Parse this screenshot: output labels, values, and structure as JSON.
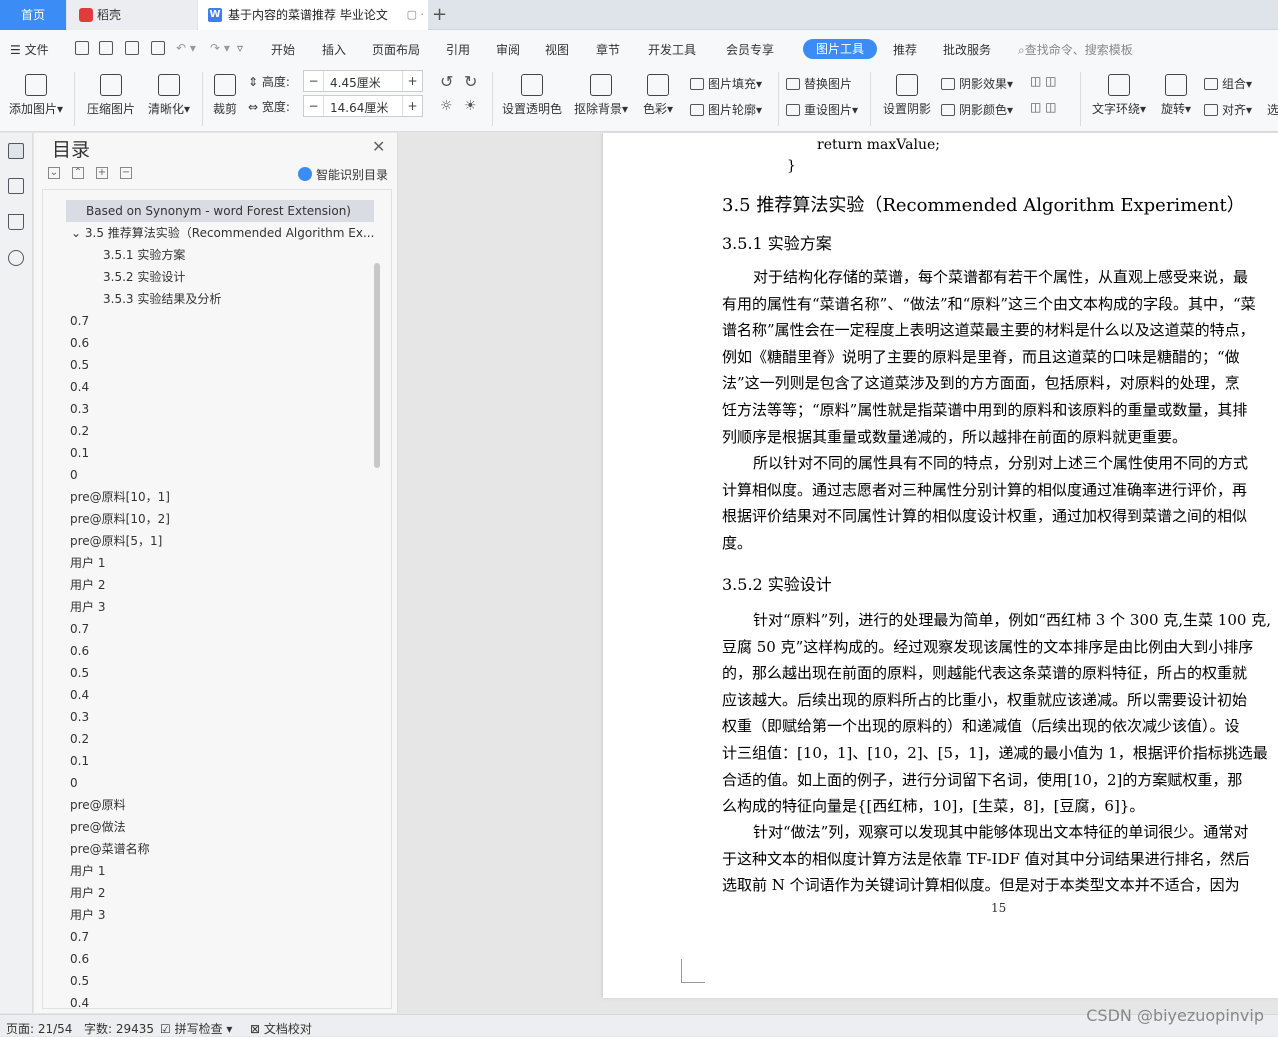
{
  "tabs": {
    "home": "首页",
    "daoke": "稻壳",
    "doc": "基于内容的菜谱推荐 毕业论文",
    "add": "+"
  },
  "menu": {
    "file": "文件",
    "items": [
      "开始",
      "插入",
      "页面布局",
      "引用",
      "审阅",
      "视图",
      "章节",
      "开发工具",
      "会员专享",
      "图片工具",
      "推荐",
      "批改服务"
    ],
    "search": "查找命令、搜索模板"
  },
  "ribbon": {
    "add_pic": "添加图片",
    "compress": "压缩图片",
    "clarify": "清晰化",
    "crop": "裁剪",
    "height_label": "高度:",
    "height_value": "4.45厘米",
    "width_label": "宽度:",
    "width_value": "14.64厘米",
    "transparent": "设置透明色",
    "remove_bg": "抠除背景",
    "color": "色彩",
    "fill": "图片填充",
    "outline": "图片轮廓",
    "replace": "替换图片",
    "reset": "重设图片",
    "shadow_set": "设置阴影",
    "shadow_effect": "阴影效果",
    "shadow_color": "阴影颜色",
    "wrap": "文字环绕",
    "rotate": "旋转",
    "group": "组合",
    "align": "对齐",
    "select": "选"
  },
  "toc": {
    "title": "目录",
    "smart": "智能识别目录",
    "items": [
      "Based on Synonym - word Forest Extension)",
      "3.5 推荐算法实验（Recommended Algorithm Ex...",
      "3.5.1 实验方案",
      "3.5.2 实验设计",
      "3.5.3 实验结果及分析",
      "0.7",
      "0.6",
      "0.5",
      "0.4",
      "0.3",
      "0.2",
      "0.1",
      "0",
      "pre@原料[10，1]",
      "pre@原料[10，2]",
      "pre@原料[5，1]",
      "用户 1",
      "用户 2",
      "用户 3",
      "0.7",
      "0.6",
      "0.5",
      "0.4",
      "0.3",
      "0.2",
      "0.1",
      "0",
      "pre@原料",
      "pre@做法",
      "pre@菜谱名称",
      "用户 1",
      "用户 2",
      "用户 3",
      "0.7",
      "0.6",
      "0.5",
      "0.4"
    ]
  },
  "doc": {
    "code1": "return maxValue;",
    "code2": "}",
    "h35": "3.5  推荐算法实验（Recommended Algorithm Experiment）",
    "h351": "3.5.1  实验方案",
    "p1": [
      "对于结构化存储的菜谱，每个菜谱都有若干个属性，从直观上感受来说，最",
      "有用的属性有“菜谱名称”、“做法”和“原料”这三个由文本构成的字段。其中，“菜",
      "谱名称”属性会在一定程度上表明这道菜最主要的材料是什么以及这道菜的特点，",
      "例如《糖醋里脊》说明了主要的原料是里脊，而且这道菜的口味是糖醋的；“做",
      "法”这一列则是包含了这道菜涉及到的方方面面，包括原料，对原料的处理，烹",
      "饪方法等等；“原料”属性就是指菜谱中用到的原料和该原料的重量或数量，其排",
      "列顺序是根据其重量或数量递减的，所以越排在前面的原料就更重要。"
    ],
    "p2": [
      "所以针对不同的属性具有不同的特点，分别对上述三个属性使用不同的方式",
      "计算相似度。通过志愿者对三种属性分别计算的相似度通过准确率进行评价，再",
      "根据评价结果对不同属性计算的相似度设计权重，通过加权得到菜谱之间的相似",
      "度。"
    ],
    "h352": "3.5.2  实验设计",
    "p3": [
      "针对“原料”列，进行的处理最为简单，例如“西红柿 3 个 300 克,生菜 100 克,",
      "豆腐 50 克”这样构成的。经过观察发现该属性的文本排序是由比例由大到小排序",
      "的，那么越出现在前面的原料，则越能代表这条菜谱的原料特征，所占的权重就",
      "应该越大。后续出现的原料所占的比重小，权重就应该递减。所以需要设计初始",
      "权重（即赋给第一个出现的原料的）和递减值（后续出现的依次减少该值）。设",
      "计三组值：[10，1]、[10，2]、[5，1]，递减的最小值为 1，根据评价指标挑选最",
      "合适的值。如上面的例子，进行分词留下名词，使用[10，2]的方案赋权重，那",
      "么构成的特征向量是{[西红柿，10]，[生菜，8]，[豆腐，6]}。"
    ],
    "p4": [
      "针对“做法”列，观察可以发现其中能够体现出文本特征的单词很少。通常对",
      "于这种文本的相似度计算方法是依靠 TF-IDF 值对其中分词结果进行排名，然后",
      "选取前 N 个词语作为关键词计算相似度。但是对于本类型文本并不适合，因为"
    ],
    "page_no": "15"
  },
  "status": {
    "page": "页面: 21/54",
    "words": "字数: 29435",
    "spell": "拼写检查",
    "proof": "文档校对"
  },
  "watermark": "CSDN @biyezuopinvip"
}
